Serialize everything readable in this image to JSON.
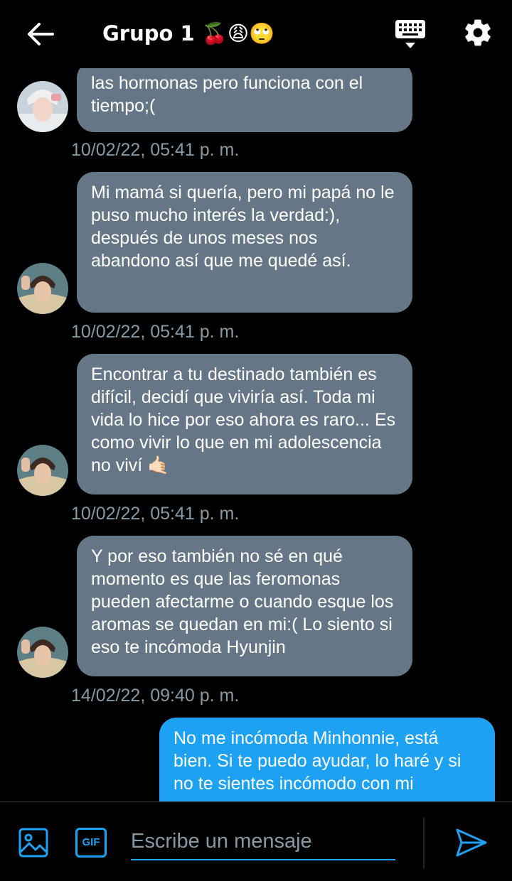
{
  "header": {
    "title": "Grupo 1 🍒😩🙄",
    "icons": [
      "back-arrow-icon",
      "keyboard-icon",
      "gear-icon"
    ]
  },
  "messages": [
    {
      "direction": "incoming",
      "text": "las hormonas pero funciona con el tiempo;(",
      "timestamp": "10/02/22, 05:41 p. m."
    },
    {
      "direction": "incoming",
      "text": "Mi mamá si quería, pero mi papá no le puso mucho interés la verdad:), después de unos meses nos abandono así que me quedé así.",
      "timestamp": "10/02/22, 05:41 p. m."
    },
    {
      "direction": "incoming",
      "text": "Encontrar a tu destinado también es difícil, decidí que viviría así. Toda mi vida lo hice por eso ahora es raro... Es como vivir lo que en mi adolescencia no viví 🤙🏻",
      "timestamp": "10/02/22, 05:41 p. m."
    },
    {
      "direction": "incoming",
      "text": "Y por eso también no sé en qué momento es que las feromonas pueden afectarme o cuando esque los aromas se quedan en mi:( Lo siento si eso te incómoda Hyunjin",
      "timestamp": "14/02/22, 09:40 p. m."
    },
    {
      "direction": "outgoing",
      "text": "No me incómoda Minhonnie, está bien. Si te puedo ayudar, lo haré y si no te sientes incómodo con mi",
      "timestamp": ""
    }
  ],
  "composer": {
    "gif_label": "GIF",
    "placeholder": "Escribe un mensaje",
    "icons": [
      "image-icon",
      "gif-icon",
      "send-icon"
    ]
  },
  "colors": {
    "background": "#000000",
    "incoming_bubble": "#657786",
    "outgoing_bubble": "#1da1f2",
    "timestamp": "#8899a6",
    "accent": "#1da1f2"
  }
}
